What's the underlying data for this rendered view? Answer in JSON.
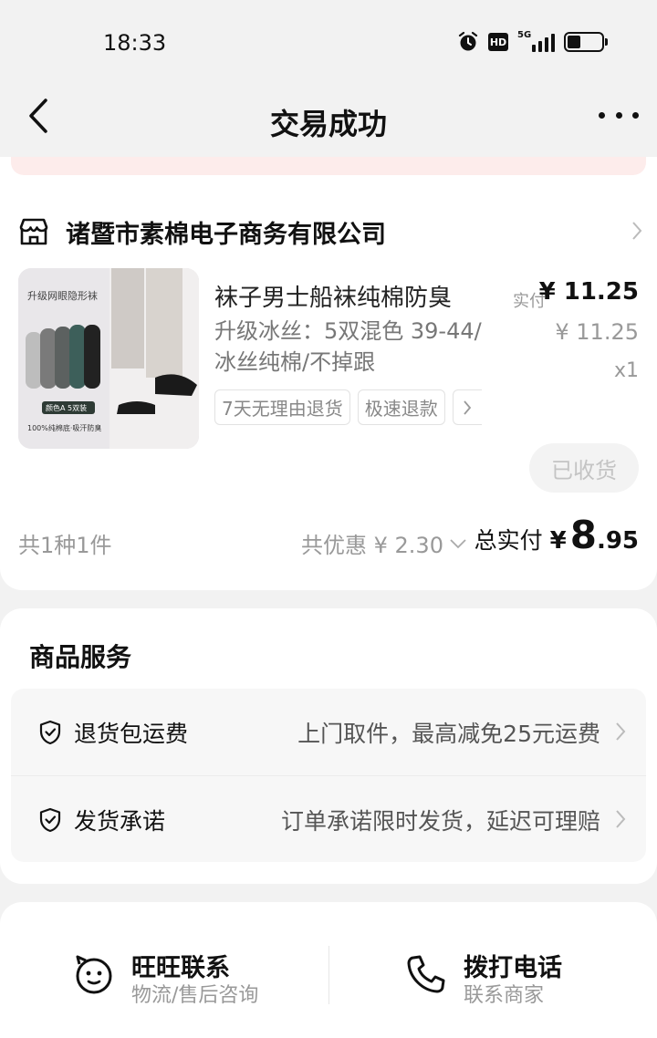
{
  "status_bar": {
    "time": "18:33",
    "hd": "HD",
    "network": "5G",
    "battery_level": 0.4
  },
  "nav": {
    "title": "交易成功"
  },
  "shop": {
    "name": "诸暨市素棉电子商务有限公司"
  },
  "product": {
    "title": "袜子男士船袜纯棉防臭",
    "spec": "升级冰丝：5双混色 39-44/冰丝纯棉/不掉跟",
    "paid_label": "实付",
    "paid_price": "¥ 11.25",
    "original_price": "¥ 11.25",
    "quantity": "x1",
    "tags": [
      "7天无理由退货",
      "极速退款"
    ],
    "image_caption_top": "升级网眼隐形袜",
    "image_caption_badge": "颜色A 5双装",
    "image_caption_bottom": "100%纯棉底·吸汗防臭"
  },
  "actions": {
    "received": "已收货"
  },
  "summary": {
    "count": "共1种1件",
    "discount": "共优惠 ¥ 2.30",
    "total_label": "总实付",
    "total_currency": "¥",
    "total_int": "8",
    "total_dec": ".95"
  },
  "services": {
    "title": "商品服务",
    "items": [
      {
        "name": "退货包运费",
        "desc": "上门取件，最高减免25元运费"
      },
      {
        "name": "发货承诺",
        "desc": "订单承诺限时发货，延迟可理赔"
      }
    ]
  },
  "contact": {
    "wangwang": {
      "title": "旺旺联系",
      "sub": "物流/售后咨询"
    },
    "phone": {
      "title": "拨打电话",
      "sub": "联系商家"
    }
  },
  "colors": {
    "background": "#f2f2f2",
    "card": "#ffffff",
    "muted_text": "#999999",
    "banner_pink": "#fdeceb"
  }
}
